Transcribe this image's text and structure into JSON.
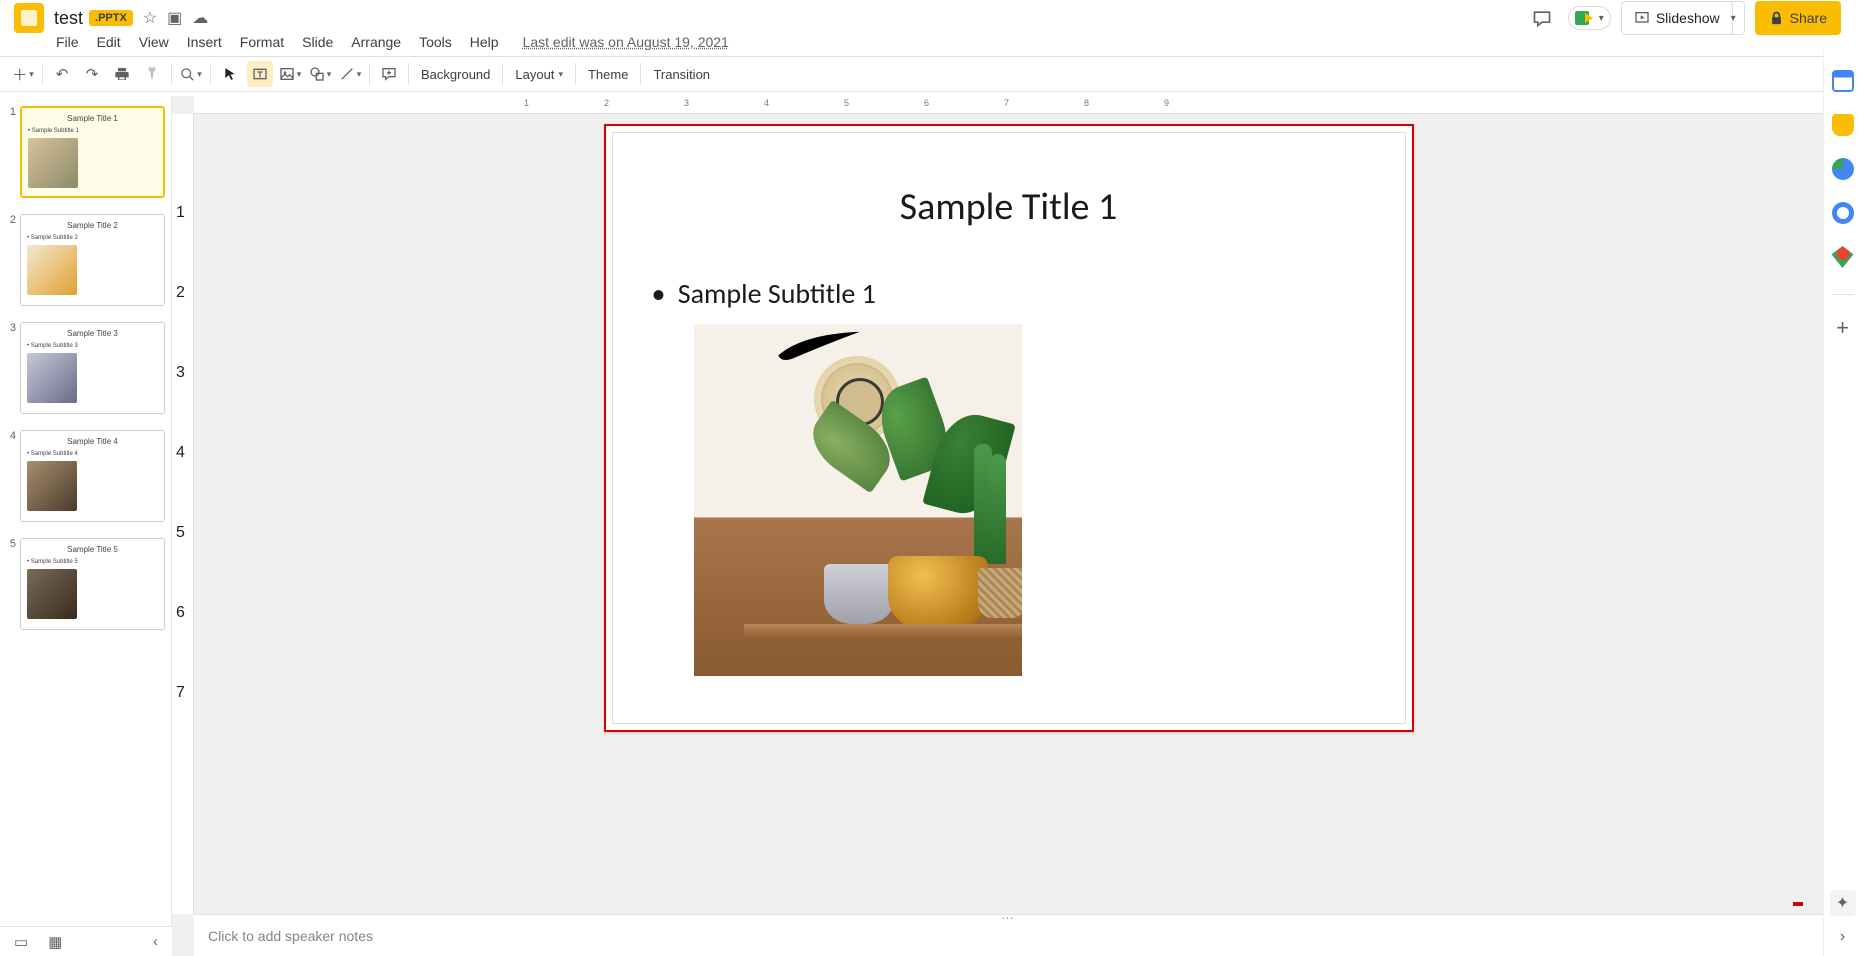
{
  "doc": {
    "title": "test",
    "badge": ".PPTX",
    "last_edit": "Last edit was on August 19, 2021"
  },
  "menus": [
    "File",
    "Edit",
    "View",
    "Insert",
    "Format",
    "Slide",
    "Arrange",
    "Tools",
    "Help"
  ],
  "toolbar": {
    "background": "Background",
    "layout": "Layout",
    "theme": "Theme",
    "transition": "Transition"
  },
  "header_buttons": {
    "slideshow": "Slideshow",
    "share": "Share"
  },
  "slides": [
    {
      "num": "1",
      "title": "Sample Title 1",
      "subtitle": "Sample Subtitle 1"
    },
    {
      "num": "2",
      "title": "Sample Title 2",
      "subtitle": "Sample Subtitle 2"
    },
    {
      "num": "3",
      "title": "Sample Title 3",
      "subtitle": "Sample Subtitle 3"
    },
    {
      "num": "4",
      "title": "Sample Title 4",
      "subtitle": "Sample Subtitle 4"
    },
    {
      "num": "5",
      "title": "Sample Title 5",
      "subtitle": "Sample Subtitle 5"
    }
  ],
  "canvas": {
    "title": "Sample Title 1",
    "subtitle": "Sample Subtitle 1"
  },
  "notes": {
    "placeholder": "Click to add speaker notes"
  },
  "ruler_h": [
    "1",
    "2",
    "3",
    "4",
    "5",
    "6",
    "7",
    "8",
    "9"
  ],
  "ruler_v": [
    "1",
    "2",
    "3",
    "4",
    "5",
    "6",
    "7"
  ]
}
